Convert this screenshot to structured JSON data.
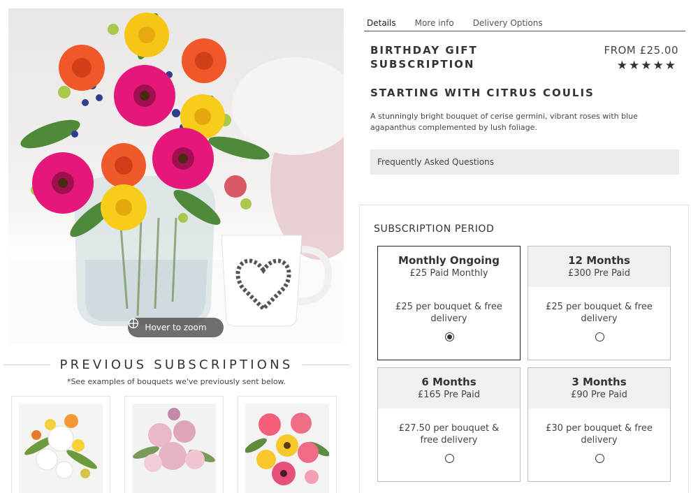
{
  "hero": {
    "zoom_hint": "Hover to zoom",
    "icons": {
      "zoom": "crosshair-circle-icon"
    }
  },
  "previous": {
    "title": "PREVIOUS SUBSCRIPTIONS",
    "note": "*See examples of bouquets we've previously sent below."
  },
  "tabs": [
    "Details",
    "More info",
    "Delivery Options"
  ],
  "product": {
    "name": "BIRTHDAY GIFT SUBSCRIPTION",
    "price": "FROM £25.00",
    "rating_stars": "★★★★★",
    "rating": 5,
    "subtitle": "STARTING WITH CITRUS COULIS",
    "description": "A stunningly bright bouquet of cerise germini, vibrant roses with blue agapanthus complemented by lush foliage.",
    "faq": "Frequently Asked Questions"
  },
  "subscription": {
    "title": "SUBSCRIPTION PERIOD",
    "options": [
      {
        "name": "Monthly Ongoing",
        "payment": "£25 Paid Monthly",
        "detail": "£25 per bouquet & free delivery",
        "selected": true
      },
      {
        "name": "12 Months",
        "payment": "£300 Pre Paid",
        "detail": "£25 per bouquet & free delivery",
        "selected": false
      },
      {
        "name": "6 Months",
        "payment": "£165 Pre Paid",
        "detail": "£27.50 per bouquet & free delivery",
        "selected": false
      },
      {
        "name": "3 Months",
        "payment": "£90 Pre Paid",
        "detail": "£30 per bouquet & free delivery",
        "selected": false
      }
    ]
  },
  "colors": {
    "option_header_bg": "#f0f0f0",
    "faq_bg": "#ebebeb",
    "text": "#333333"
  }
}
